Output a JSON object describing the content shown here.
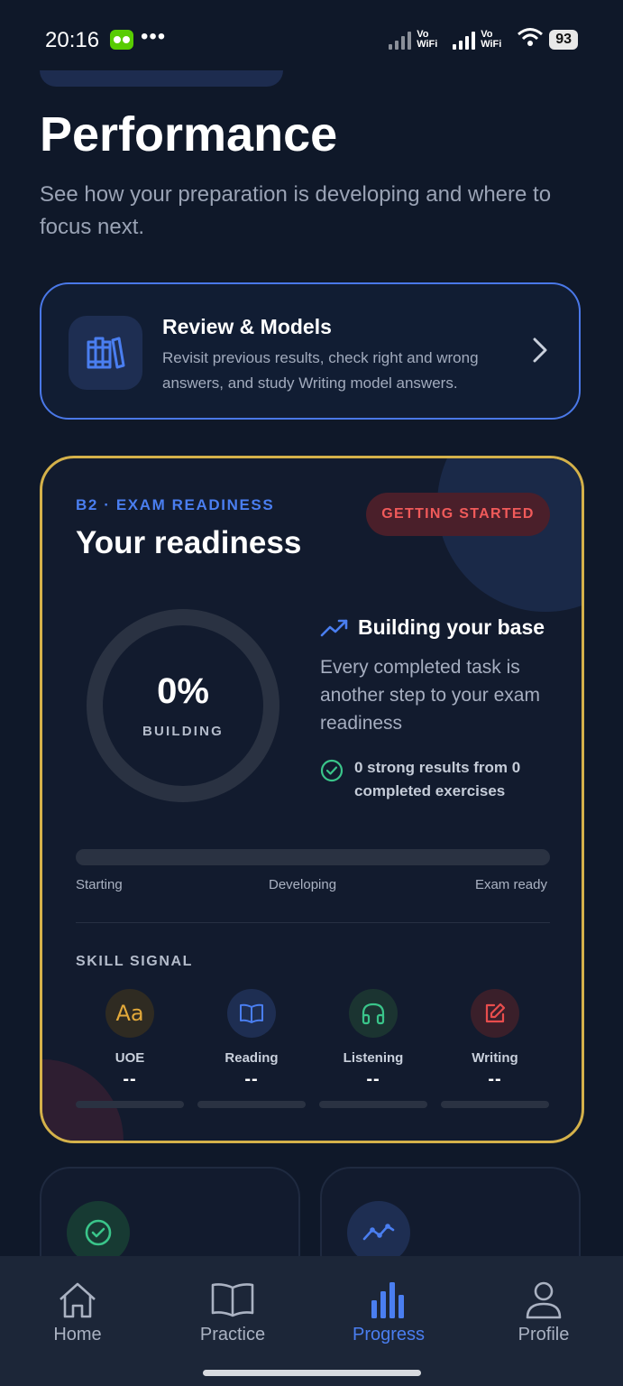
{
  "status_bar": {
    "time": "20:16",
    "more": "•••",
    "vowifi_1": "Vo WiFi",
    "vowifi_2": "Vo WiFi",
    "battery": "93"
  },
  "page": {
    "title": "Performance",
    "subtitle": "See how your preparation is developing and where to focus next."
  },
  "review_card": {
    "icon": "books-icon",
    "title": "Review & Models",
    "description": "Revisit previous results, check right and wrong answers, and study Writing model answers."
  },
  "readiness": {
    "eyebrow": "B2 · EXAM READINESS",
    "title": "Your readiness",
    "badge": "GETTING STARTED",
    "percent": "0%",
    "percent_value": 0,
    "ring_label": "BUILDING",
    "status_title": "Building your base",
    "status_desc": "Every completed task is another step to your exam readiness",
    "results_text": "0 strong results from 0 completed exercises",
    "progress_value": 0,
    "scale": [
      "Starting",
      "Developing",
      "Exam ready"
    ],
    "skill_heading": "SKILL SIGNAL",
    "skills": [
      {
        "name": "UOE",
        "value": "--",
        "icon": "aa-text-icon",
        "color": "#e3a93a"
      },
      {
        "name": "Reading",
        "value": "--",
        "icon": "open-book-icon",
        "color": "#4a7ef0"
      },
      {
        "name": "Listening",
        "value": "--",
        "icon": "headphones-icon",
        "color": "#3ac58a"
      },
      {
        "name": "Writing",
        "value": "--",
        "icon": "edit-icon",
        "color": "#e84d4d"
      }
    ]
  },
  "tabs": [
    {
      "label": "Home",
      "icon": "home-icon",
      "active": false
    },
    {
      "label": "Practice",
      "icon": "book-icon",
      "active": false
    },
    {
      "label": "Progress",
      "icon": "bar-chart-icon",
      "active": true
    },
    {
      "label": "Profile",
      "icon": "person-icon",
      "active": false
    }
  ],
  "colors": {
    "accent": "#4a7ef0",
    "readiness_border": "#d4b14a",
    "badge_text": "#f05a5a",
    "background": "#0f1829"
  }
}
